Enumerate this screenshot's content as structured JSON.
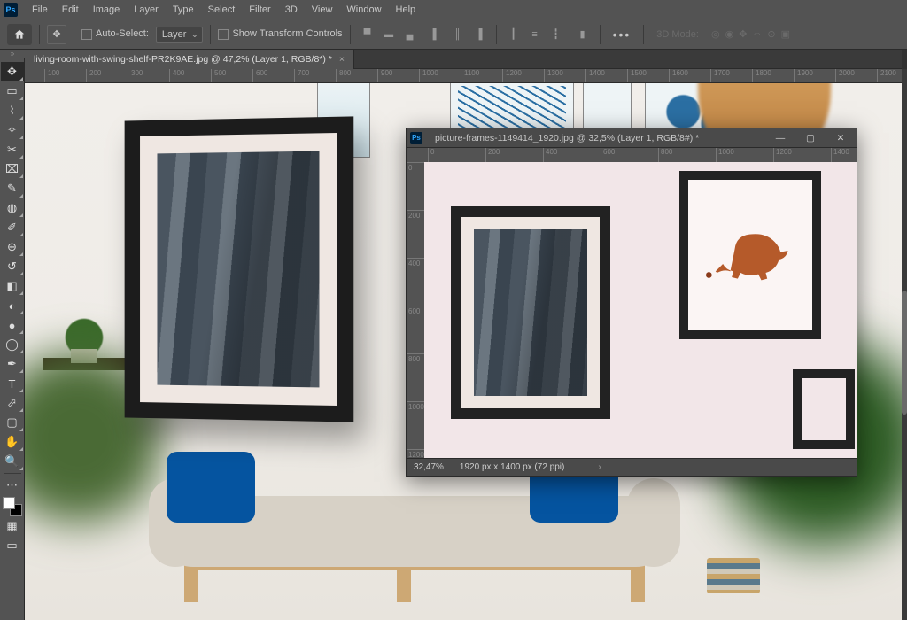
{
  "menu": [
    "File",
    "Edit",
    "Image",
    "Layer",
    "Type",
    "Select",
    "Filter",
    "3D",
    "View",
    "Window",
    "Help"
  ],
  "options": {
    "auto_select_label": "Auto-Select:",
    "auto_select_target": "Layer",
    "show_transform_label": "Show Transform Controls",
    "mode3d_label": "3D Mode:"
  },
  "main_tab": {
    "title": "living-room-with-swing-shelf-PR2K9AE.jpg @ 47,2% (Layer 1, RGB/8*) *"
  },
  "ruler_main": [
    "100",
    "200",
    "300",
    "400",
    "500",
    "600",
    "700",
    "800",
    "900",
    "1000",
    "1100",
    "1200",
    "1300",
    "1400",
    "1500",
    "1600",
    "1700",
    "1800",
    "1900",
    "2000",
    "2100"
  ],
  "float": {
    "title": "picture-frames-1149414_1920.jpg @ 32,5% (Layer 1, RGB/8#) *",
    "ruler_h": [
      "0",
      "200",
      "400",
      "600",
      "800",
      "1000",
      "1200",
      "1400"
    ],
    "ruler_v": [
      "0",
      "200",
      "400",
      "600",
      "800",
      "1000",
      "1200"
    ],
    "status_zoom": "32,47%",
    "status_dims": "1920 px x 1400 px (72 ppi)"
  },
  "tools": [
    {
      "n": "move-tool",
      "g": "✥",
      "active": true
    },
    {
      "n": "marquee-tool",
      "g": "▭"
    },
    {
      "n": "lasso-tool",
      "g": "⌇"
    },
    {
      "n": "magic-wand-tool",
      "g": "✧"
    },
    {
      "n": "crop-tool",
      "g": "✂"
    },
    {
      "n": "frame-tool",
      "g": "⌧"
    },
    {
      "n": "eyedropper-tool",
      "g": "✎"
    },
    {
      "n": "spot-heal-tool",
      "g": "◍"
    },
    {
      "n": "brush-tool",
      "g": "✐"
    },
    {
      "n": "clone-stamp-tool",
      "g": "⊕"
    },
    {
      "n": "history-brush-tool",
      "g": "↺"
    },
    {
      "n": "eraser-tool",
      "g": "◧"
    },
    {
      "n": "gradient-tool",
      "g": "◐"
    },
    {
      "n": "blur-tool",
      "g": "●"
    },
    {
      "n": "dodge-tool",
      "g": "◯"
    },
    {
      "n": "pen-tool",
      "g": "✒"
    },
    {
      "n": "type-tool",
      "g": "T"
    },
    {
      "n": "path-select-tool",
      "g": "⬀"
    },
    {
      "n": "rectangle-tool",
      "g": "▢"
    },
    {
      "n": "hand-tool",
      "g": "✋"
    },
    {
      "n": "zoom-tool",
      "g": "🔍"
    }
  ]
}
